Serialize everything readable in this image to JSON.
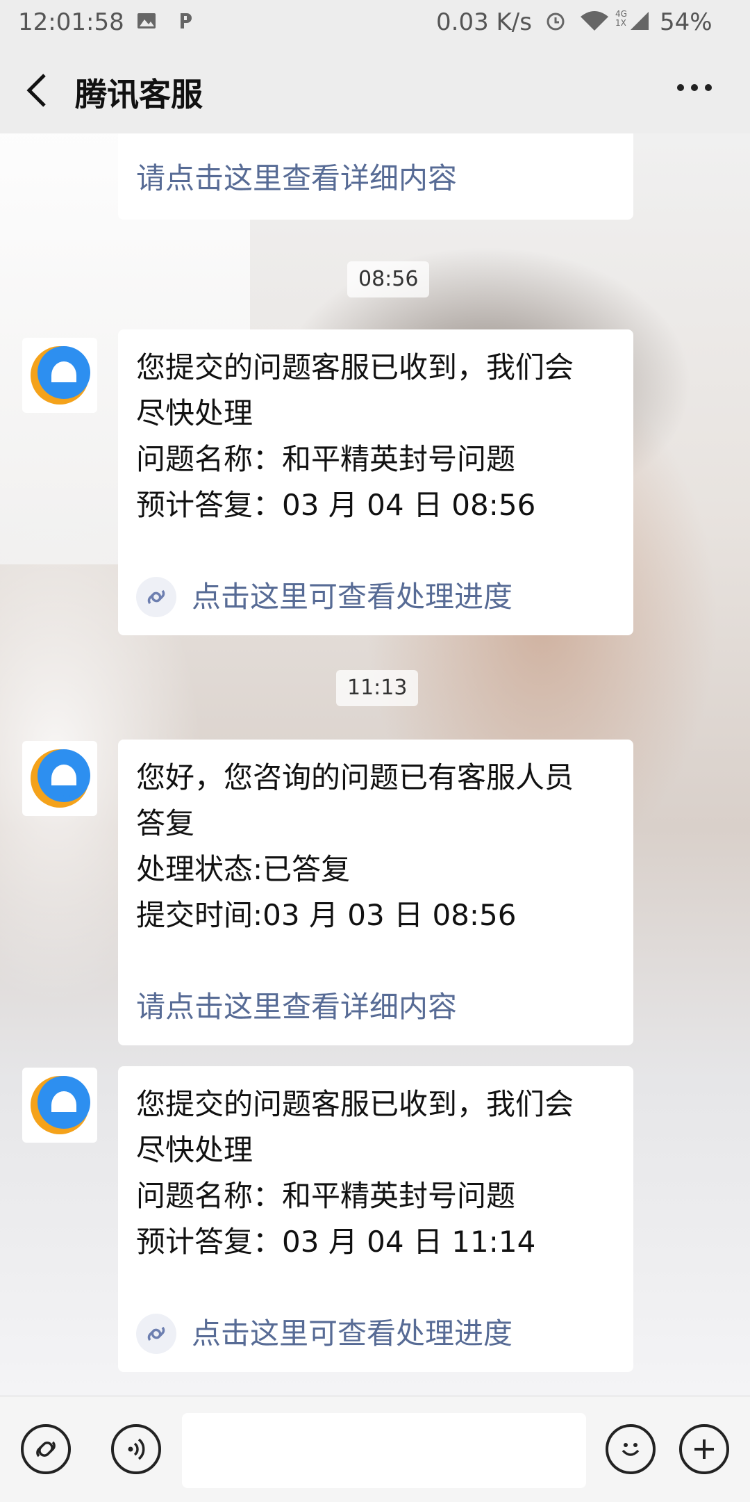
{
  "status_bar": {
    "time": "12:01:58",
    "speed": "0.03 K/s",
    "network": "4G 1X",
    "battery": "54%"
  },
  "header": {
    "title": "腾讯客服",
    "back_icon": "chevron-left-icon",
    "more_icon": "more-dots-icon"
  },
  "messages": [
    {
      "type": "partial-card",
      "link": "请点击这里查看详细内容"
    },
    {
      "type": "timestamp",
      "text": "08:56"
    },
    {
      "type": "card",
      "lines": [
        "您提交的问题客服已收到，我们会",
        "尽快处理",
        "问题名称：和平精英封号问题",
        "预计答复：03 月 04 日 08:56"
      ],
      "link": "点击这里可查看处理进度"
    },
    {
      "type": "timestamp",
      "text": "11:13"
    },
    {
      "type": "card",
      "lines": [
        "您好，您咨询的问题已有客服人员",
        "答复",
        "处理状态:已答复",
        "提交时间:03 月 03 日 08:56"
      ],
      "link": "请点击这里查看详细内容"
    },
    {
      "type": "card",
      "lines": [
        "您提交的问题客服已收到，我们会",
        "尽快处理",
        "问题名称：和平精英封号问题",
        "预计答复：03 月 04 日 11:14"
      ],
      "link": "点击这里可查看处理进度"
    }
  ],
  "colors": {
    "link": "#576b95",
    "avatar_blue": "#2d8ff0",
    "avatar_orange": "#f4a21b"
  }
}
